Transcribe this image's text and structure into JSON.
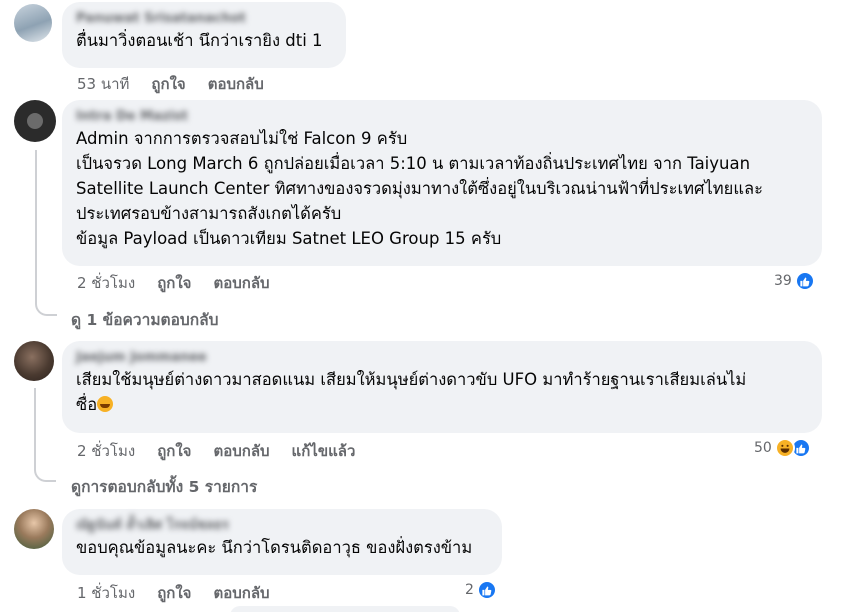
{
  "comments": [
    {
      "author": "Panuwat Srisatanachot",
      "lines": [
        "ตื่นมาวิ่งตอนเช้า นึกว่าเรายิง dti 1"
      ],
      "time": "53 นาที",
      "like_label": "ถูกใจ",
      "reply_label": "ตอบกลับ"
    },
    {
      "author": "Intra De Mazist",
      "lines": [
        "Admin จากการตรวจสอบไม่ใช่ Falcon 9 ครับ",
        "เป็นจรวด Long March 6 ถูกปล่อยเมื่อเวลา 5:10 น ตามเวลาท้องถิ่นประเทศไทย จาก Taiyuan",
        "Satellite Launch Center ทิศทางของจรวดมุ่งมาทางใต้ซึ่งอยู่ในบริเวณน่านฟ้าที่ประเทศไทยและ",
        "ประเทศรอบข้างสามารถสังเกตได้ครับ",
        "ข้อมูล Payload เป็นดาวเทียม Satnet LEO Group 15 ครับ"
      ],
      "time": "2 ชั่วโมง",
      "like_label": "ถูกใจ",
      "reply_label": "ตอบกลับ",
      "reaction_count": "39",
      "reaction_icons": [
        "like-icon"
      ]
    },
    {
      "author": "Jaejum Jommanee",
      "lines": [
        "เสียมใช้มนุษย์ต่างดาวมาสอดแนม เสียมให้มนุษย์ต่างดาวขับ UFO มาทำร้ายฐานเราเสียมเล่นไม่",
        "ซื่อ"
      ],
      "time": "2 ชั่วโมง",
      "like_label": "ถูกใจ",
      "reply_label": "ตอบกลับ",
      "edited_label": "แก้ไขแล้ว",
      "reaction_count": "50",
      "reaction_icons": [
        "haha-icon",
        "like-icon"
      ]
    },
    {
      "author": "ณัฐนันท์ ล้ำเลิศ โรจน์ชลธร",
      "lines": [
        "ขอบคุณข้อมูลนะคะ นึกว่าโดรนติดอาวุธ ของฝั่งตรงข้าม"
      ],
      "time": "1 ชั่วโมง",
      "like_label": "ถูกใจ",
      "reply_label": "ตอบกลับ",
      "reaction_count": "2",
      "reaction_icons": [
        "like-icon"
      ]
    }
  ],
  "view_replies": [
    "ดู 1 ข้อความตอบกลับ",
    "ดูการตอบกลับทั้ง 5 รายการ"
  ],
  "colors": {
    "bubble": "#f0f2f5",
    "secondary_text": "#65676b",
    "like_blue": "#1877f2",
    "haha_yellow": "#f7b125"
  }
}
